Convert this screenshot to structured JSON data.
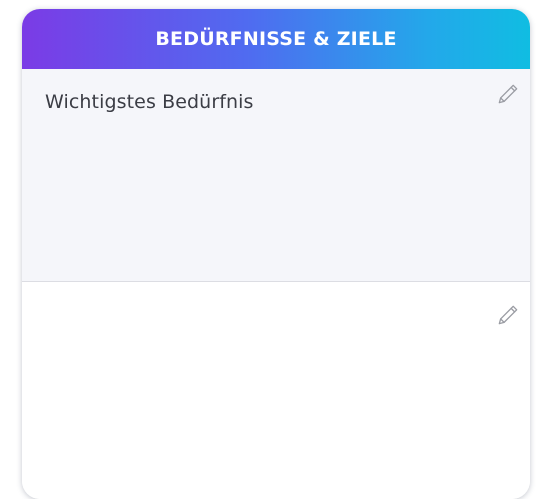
{
  "card": {
    "title": "BEDÜRFNISSE & ZIELE",
    "gradient": [
      "#7b3be6",
      "#4f6cf0",
      "#23a8ea",
      "#10bde2"
    ],
    "sections": [
      {
        "label": "Wichtigstes Bedürfnis",
        "icon": "pencil-icon"
      },
      {
        "label": "",
        "icon": "pencil-icon"
      }
    ]
  }
}
